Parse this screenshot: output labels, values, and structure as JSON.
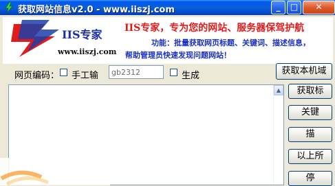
{
  "window": {
    "title": "获取网站信息v2.0 - www.iiszj.com",
    "min_glyph": "_",
    "max_glyph": "□",
    "close_glyph": "✕"
  },
  "header": {
    "logo_text": "IIS专家",
    "logo_url": "www.iiszj.com",
    "slogan": "IIS专家，专为您的网站、服务器保驾护航",
    "desc_line1": "功能：批量获取网页标题、关键词、描述信息，",
    "desc_line2": "帮助管理员快速发现问题网站！"
  },
  "options": {
    "encoding_label": "网页编码：",
    "manual_label": "手工输",
    "encoding_value": "gb2312",
    "generate_label": "生成"
  },
  "buttons": {
    "get_local": "获取本机域",
    "get_title": "获取标",
    "keywords": "关键",
    "describe": "描",
    "above_all": "以上所",
    "stop": "停"
  },
  "colors": {
    "title_bar": "#0a5fd8",
    "slogan": "#e21b1b",
    "desc": "#1a2fc8",
    "logo": "#1a2fa8"
  }
}
